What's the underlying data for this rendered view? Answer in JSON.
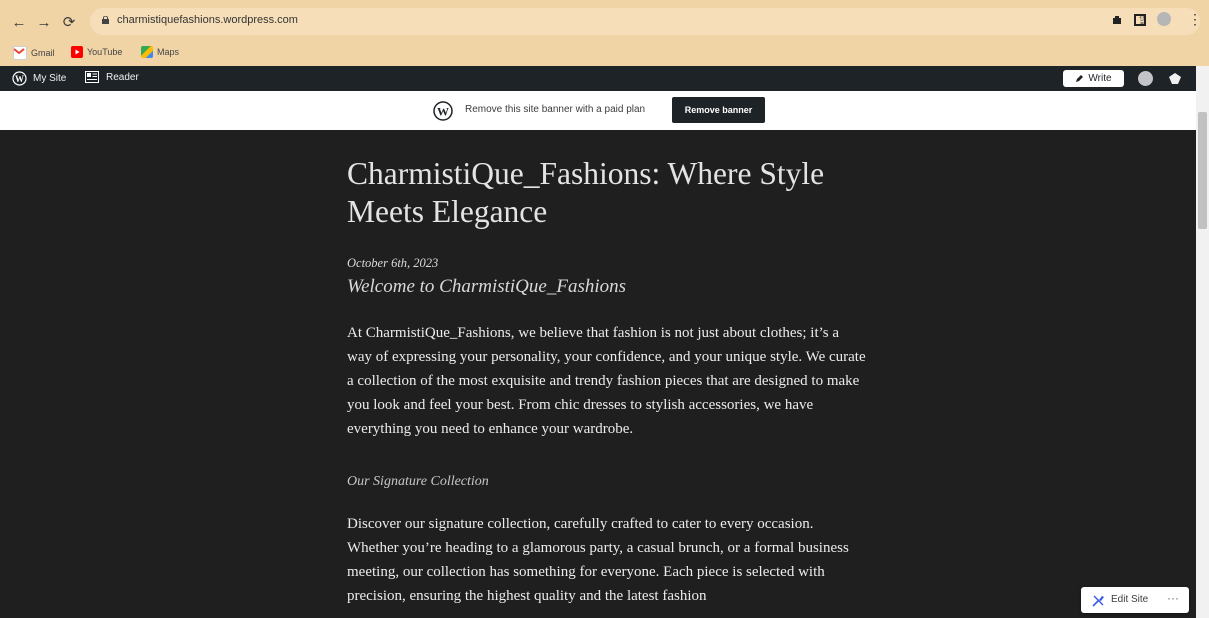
{
  "browser": {
    "url": "charmistiquefashions.wordpress.com",
    "bookmarks": [
      {
        "label": "Gmail",
        "icon": "gmail-icon"
      },
      {
        "label": "YouTube",
        "icon": "youtube-icon"
      },
      {
        "label": "Maps",
        "icon": "maps-icon"
      }
    ]
  },
  "admin_bar": {
    "my_site": "My Site",
    "reader": "Reader",
    "write": "Write"
  },
  "banner": {
    "text": "Remove this site banner with a paid plan",
    "button": "Remove banner"
  },
  "post": {
    "title": "CharmistiQue_Fashions: Where Style Meets Elegance",
    "date": "October 6th, 2023",
    "subtitle": "Welcome to CharmistiQue_Fashions",
    "paragraph1": "At CharmistiQue_Fashions, we believe that fashion is not just about clothes; it’s a way of expressing your personality, your confidence, and your unique style. We curate a collection of the most exquisite and trendy fashion pieces that are designed to make you look and feel your best. From chic dresses to stylish accessories, we have everything you need to enhance your wardrobe.",
    "section_heading": "Our Signature Collection",
    "paragraph2": "Discover our signature collection, carefully crafted to cater to every occasion. Whether you’re heading to a glamorous party, a casual brunch, or a formal business meeting, our collection has something for everyone. Each piece is selected with precision, ensuring the highest quality and the latest fashion"
  },
  "edit_site": {
    "label": "Edit Site",
    "more": "···"
  },
  "colors": {
    "chrome": "#f0d4a6",
    "admin_bar": "#1d2327",
    "page_bg": "#1f1f1f",
    "text": "#ececec"
  }
}
